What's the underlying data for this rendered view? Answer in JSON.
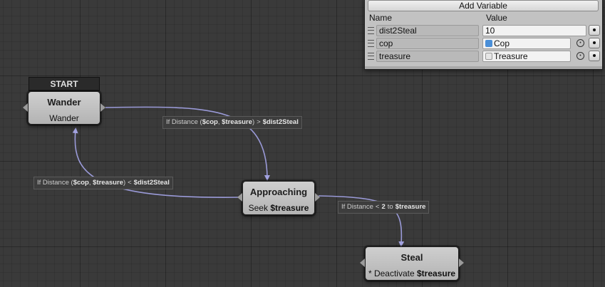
{
  "variables_panel": {
    "add_button": "Add Variable",
    "columns": {
      "name": "Name",
      "value": "Value"
    },
    "rows": [
      {
        "name": "dist2Steal",
        "value": "10",
        "type": "number"
      },
      {
        "name": "cop",
        "value": "Cop",
        "type": "object",
        "icon": "cube-icon",
        "icon_color": "#4a8fd8"
      },
      {
        "name": "treasure",
        "value": "Treasure",
        "type": "object",
        "icon": "cube-outline-icon",
        "icon_color": "#dddddd"
      }
    ]
  },
  "nodes": {
    "start_label": "START",
    "wander": {
      "title": "Wander",
      "action": "Wander"
    },
    "approaching": {
      "title": "Approaching",
      "action_prefix": "Seek",
      "action_arg": "$treasure"
    },
    "steal": {
      "title": "Steal",
      "action_prefix": "* Deactivate",
      "action_arg": "$treasure"
    }
  },
  "transitions": {
    "wander_to_approaching": {
      "prefix": "If Distance (",
      "arg1": "$cop",
      "sep": ", ",
      "arg2": "$treasure",
      "suffix": ")",
      "op": ">",
      "rhs": "$dist2Steal"
    },
    "approaching_to_wander": {
      "prefix": "If Distance (",
      "arg1": "$cop",
      "sep": ", ",
      "arg2": "$treasure",
      "suffix": ")",
      "op": "<",
      "rhs": "$dist2Steal"
    },
    "approaching_to_steal": {
      "prefix": "If Distance",
      "op": "<",
      "value": "2",
      "mid": "to",
      "rhs": "$treasure"
    }
  },
  "colors": {
    "canvas": "#3a3a3a",
    "edge": "#9a9ad8",
    "node": "#c4c4c4"
  }
}
